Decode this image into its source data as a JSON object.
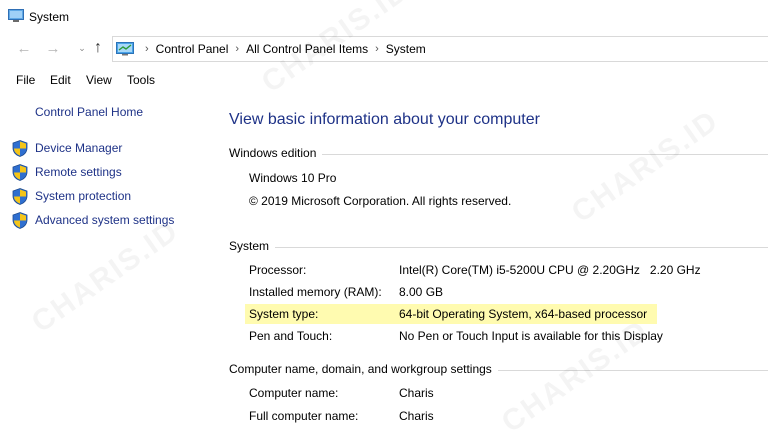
{
  "window": {
    "title": "System"
  },
  "nav": {
    "back_icon": "back-arrow-icon",
    "forward_icon": "forward-arrow-icon",
    "up_icon": "up-arrow-icon",
    "breadcrumb": [
      "Control Panel",
      "All Control Panel Items",
      "System"
    ]
  },
  "menu": [
    "File",
    "Edit",
    "View",
    "Tools"
  ],
  "sidebar": {
    "home": "Control Panel Home",
    "links": [
      "Device Manager",
      "Remote settings",
      "System protection",
      "Advanced system settings"
    ]
  },
  "main": {
    "heading": "View basic information about your computer",
    "edition": {
      "title": "Windows edition",
      "name": "Windows 10 Pro",
      "copyright": "© 2019 Microsoft Corporation. All rights reserved."
    },
    "system": {
      "title": "System",
      "rows": [
        {
          "label": "Processor:",
          "value": "Intel(R) Core(TM) i5-5200U CPU @ 2.20GHz   2.20 GHz"
        },
        {
          "label": "Installed memory (RAM):",
          "value": "8.00 GB"
        },
        {
          "label": "System type:",
          "value": "64-bit Operating System, x64-based processor"
        },
        {
          "label": "Pen and Touch:",
          "value": "No Pen or Touch Input is available for this Display"
        }
      ]
    },
    "computer": {
      "title": "Computer name, domain, and workgroup settings",
      "rows": [
        {
          "label": "Computer name:",
          "value": "Charis"
        },
        {
          "label": "Full computer name:",
          "value": "Charis"
        }
      ]
    }
  },
  "colors": {
    "link": "#1e3287",
    "highlight": "#fffbb0",
    "divider": "#d9d9d9"
  },
  "watermark": "CHARIS.ID"
}
